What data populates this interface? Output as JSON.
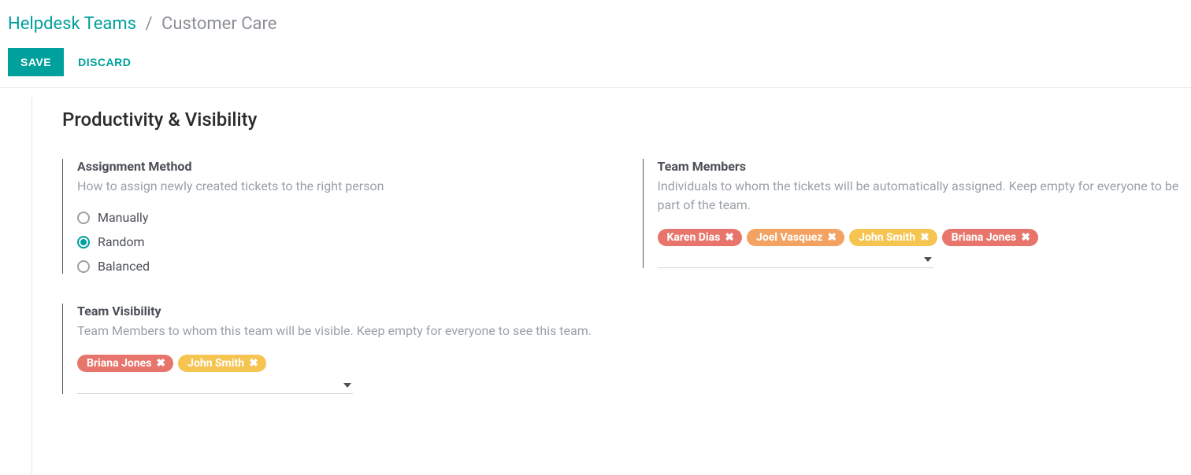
{
  "breadcrumb": {
    "parent": "Helpdesk Teams",
    "separator": "/",
    "current": "Customer Care"
  },
  "actions": {
    "save": "SAVE",
    "discard": "DISCARD"
  },
  "section": {
    "title": "Productivity & Visibility"
  },
  "assignment": {
    "title": "Assignment Method",
    "desc": "How to assign newly created tickets to the right person",
    "options": {
      "manually": "Manually",
      "random": "Random",
      "balanced": "Balanced"
    },
    "selected": "random"
  },
  "visibility": {
    "title": "Team Visibility",
    "desc": "Team Members to whom this team will be visible. Keep empty for everyone to see this team.",
    "tags": [
      {
        "name": "Briana Jones",
        "color": "tag-red"
      },
      {
        "name": "John Smith",
        "color": "tag-yellow"
      }
    ]
  },
  "members": {
    "title": "Team Members",
    "desc": "Individuals to whom the tickets will be automatically assigned. Keep empty for everyone to be part of the team.",
    "tags": [
      {
        "name": "Karen Dias",
        "color": "tag-red"
      },
      {
        "name": "Joel Vasquez",
        "color": "tag-orange"
      },
      {
        "name": "John Smith",
        "color": "tag-yellow"
      },
      {
        "name": "Briana Jones",
        "color": "tag-red2"
      }
    ]
  }
}
